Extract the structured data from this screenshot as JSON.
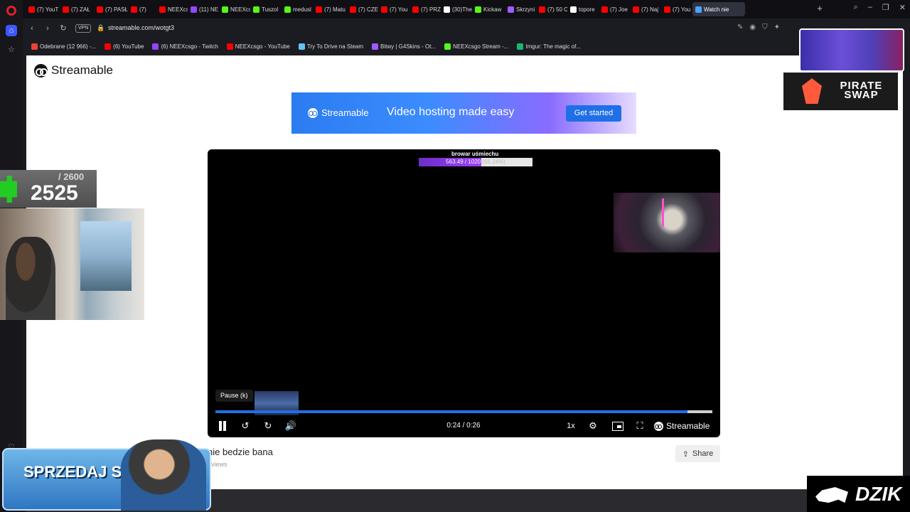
{
  "tabs": [
    {
      "label": "(7) YouT",
      "color": "#ff0000"
    },
    {
      "label": "(7) ZAŁ",
      "color": "#ff0000"
    },
    {
      "label": "(7) PASŁ",
      "color": "#ff0000"
    },
    {
      "label": "(7) ",
      "color": "#ff0000"
    },
    {
      "label": "NEEXcs",
      "color": "#ff0000"
    },
    {
      "label": "(11) NE",
      "color": "#9146ff"
    },
    {
      "label": "NEEXcs",
      "color": "#53fc18"
    },
    {
      "label": "Tuszol",
      "color": "#53fc18"
    },
    {
      "label": "medusl",
      "color": "#53fc18"
    },
    {
      "label": "(7) Matu",
      "color": "#ff0000"
    },
    {
      "label": "(7) CZE",
      "color": "#ff0000"
    },
    {
      "label": "(7) You",
      "color": "#ff0000"
    },
    {
      "label": "(7) PRZ",
      "color": "#ff0000"
    },
    {
      "label": "(30)The",
      "color": "#ffffff"
    },
    {
      "label": "Kickaw",
      "color": "#53fc18"
    },
    {
      "label": "Skrzyni",
      "color": "#a05cff"
    },
    {
      "label": "(7) 50 C",
      "color": "#ff0000"
    },
    {
      "label": "topore",
      "color": "#ffffff"
    },
    {
      "label": "(7) Joe",
      "color": "#ff0000"
    },
    {
      "label": "(7) Naj",
      "color": "#ff0000"
    },
    {
      "label": "(7) You",
      "color": "#ff0000"
    },
    {
      "label": "Watch nie",
      "color": "#4aa3ff",
      "active": true
    }
  ],
  "addressbar": {
    "vpn_label": "VPN",
    "url": "streamable.com/wotgt3"
  },
  "bookmarks": [
    {
      "label": "Odebrane (12 966) -...",
      "color": "#ea4335"
    },
    {
      "label": "(6) YouTube",
      "color": "#ff0000"
    },
    {
      "label": "(6) NEEXcsgo - Twitch",
      "color": "#9146ff"
    },
    {
      "label": "NEEXcsgo - YouTube",
      "color": "#ff0000"
    },
    {
      "label": "Try To Drive na Steam",
      "color": "#66c0f4"
    },
    {
      "label": "Bitwy | G4Skins - Ot...",
      "color": "#a05cff"
    },
    {
      "label": "NEEXcsgo Stream -...",
      "color": "#53fc18"
    },
    {
      "label": "Imgur: The magic of...",
      "color": "#1bb76e"
    }
  ],
  "page": {
    "brand": "Streamable",
    "banner": {
      "brand": "Streamable",
      "tagline": "Video hosting made easy",
      "cta": "Get started"
    },
    "player": {
      "overlay_title": "browar uśmiechu",
      "overlay_progress_text": "563.49 / 1020",
      "overlay_progress_pct": "(55.24%)",
      "overlay_progress_value": 0.5524,
      "tooltip": "Pause (k)",
      "time": "0:24 / 0:26",
      "played_fraction": 0.95,
      "speed": "1x",
      "brand": "Streamable"
    },
    "video_title": "nie bedzie bana",
    "views": "views",
    "share_label": "Share"
  },
  "overlays": {
    "score_total": "/ 2600",
    "score_value": "2525",
    "pirate_brand": "PIRATE SWAP",
    "promo_text": "SPRZEDAJ SKINY",
    "sponsor_brand": "DZIK"
  }
}
